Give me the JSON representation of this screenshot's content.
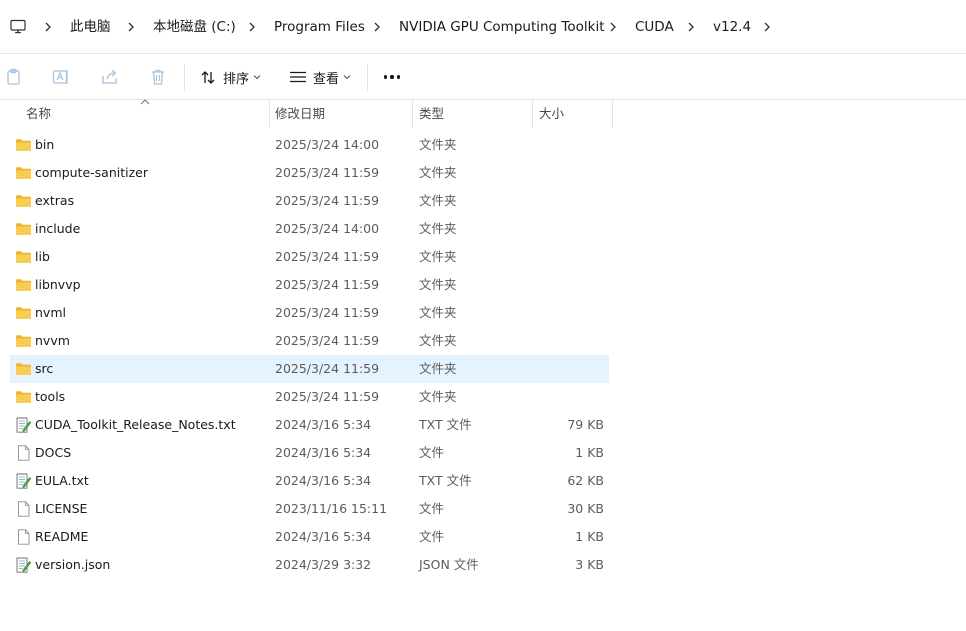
{
  "breadcrumb": [
    "此电脑",
    "本地磁盘 (C:)",
    "Program Files",
    "NVIDIA GPU Computing Toolkit",
    "CUDA",
    "v12.4"
  ],
  "toolbar": {
    "sort_label": "排序",
    "view_label": "查看"
  },
  "columns": {
    "name": "名称",
    "date": "修改日期",
    "type": "类型",
    "size": "大小"
  },
  "files": [
    {
      "name": "bin",
      "date": "2025/3/24 14:00",
      "type": "文件夹",
      "size": "",
      "icon": "folder-icon"
    },
    {
      "name": "compute-sanitizer",
      "date": "2025/3/24 11:59",
      "type": "文件夹",
      "size": "",
      "icon": "folder-icon"
    },
    {
      "name": "extras",
      "date": "2025/3/24 11:59",
      "type": "文件夹",
      "size": "",
      "icon": "folder-icon"
    },
    {
      "name": "include",
      "date": "2025/3/24 14:00",
      "type": "文件夹",
      "size": "",
      "icon": "folder-icon"
    },
    {
      "name": "lib",
      "date": "2025/3/24 11:59",
      "type": "文件夹",
      "size": "",
      "icon": "folder-icon"
    },
    {
      "name": "libnvvp",
      "date": "2025/3/24 11:59",
      "type": "文件夹",
      "size": "",
      "icon": "folder-icon"
    },
    {
      "name": "nvml",
      "date": "2025/3/24 11:59",
      "type": "文件夹",
      "size": "",
      "icon": "folder-icon"
    },
    {
      "name": "nvvm",
      "date": "2025/3/24 11:59",
      "type": "文件夹",
      "size": "",
      "icon": "folder-icon"
    },
    {
      "name": "src",
      "date": "2025/3/24 11:59",
      "type": "文件夹",
      "size": "",
      "icon": "folder-icon",
      "selected": true
    },
    {
      "name": "tools",
      "date": "2025/3/24 11:59",
      "type": "文件夹",
      "size": "",
      "icon": "folder-icon"
    },
    {
      "name": "CUDA_Toolkit_Release_Notes.txt",
      "date": "2024/3/16 5:34",
      "type": "TXT 文件",
      "size": "79 KB",
      "icon": "text-file-icon"
    },
    {
      "name": "DOCS",
      "date": "2024/3/16 5:34",
      "type": "文件",
      "size": "1 KB",
      "icon": "file-icon"
    },
    {
      "name": "EULA.txt",
      "date": "2024/3/16 5:34",
      "type": "TXT 文件",
      "size": "62 KB",
      "icon": "text-file-icon"
    },
    {
      "name": "LICENSE",
      "date": "2023/11/16 15:11",
      "type": "文件",
      "size": "30 KB",
      "icon": "file-icon"
    },
    {
      "name": "README",
      "date": "2024/3/16 5:34",
      "type": "文件",
      "size": "1 KB",
      "icon": "file-icon"
    },
    {
      "name": "version.json",
      "date": "2024/3/29 3:32",
      "type": "JSON 文件",
      "size": "3 KB",
      "icon": "text-file-icon"
    }
  ],
  "colors": {
    "selected_row": "#e5f3ff",
    "folder": "#f8c74a",
    "text_secondary": "#5c5c5c"
  }
}
